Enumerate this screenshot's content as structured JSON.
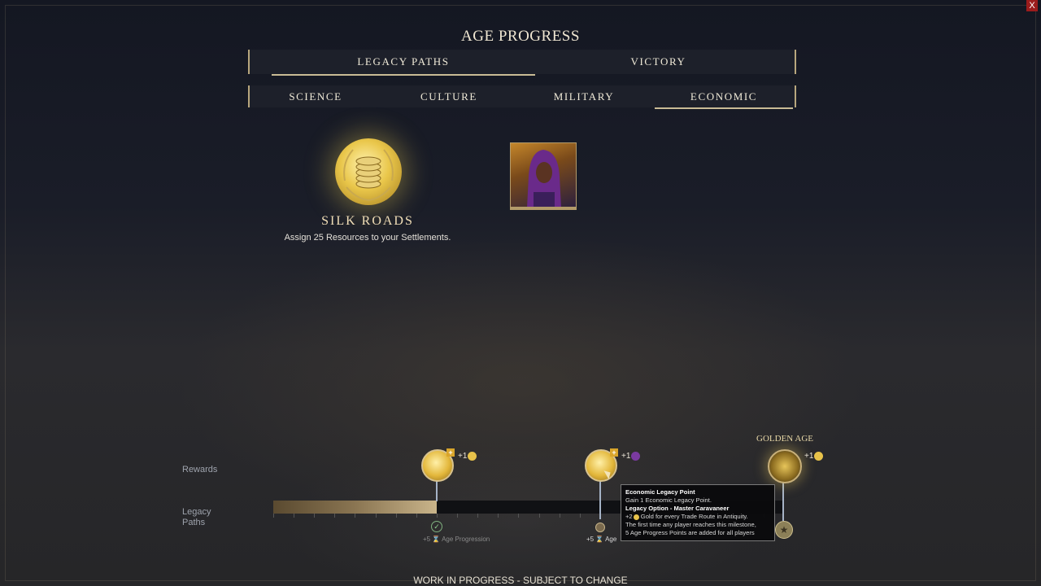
{
  "window": {
    "close_label": "X"
  },
  "title": "AGE PROGRESS",
  "main_tabs": [
    {
      "label": "LEGACY PATHS",
      "active": true
    },
    {
      "label": "VICTORY",
      "active": false
    }
  ],
  "sub_tabs": [
    {
      "label": "SCIENCE",
      "active": false
    },
    {
      "label": "CULTURE",
      "active": false
    },
    {
      "label": "MILITARY",
      "active": false
    },
    {
      "label": "ECONOMIC",
      "active": true
    }
  ],
  "legacy_path": {
    "icon": "gold-coins-laurel-icon",
    "title": "SILK ROADS",
    "description": "Assign 25 Resources to your Settlements."
  },
  "leader_portrait": {
    "icon": "leader-portrait-icon"
  },
  "progress": {
    "rows": {
      "rewards": "Rewards",
      "legacy_paths": "Legacy Paths"
    },
    "fill_fraction": 0.32,
    "milestones": [
      {
        "reward_text": "+1",
        "reward_icon": "gold-icon",
        "progression_text": "+5",
        "progression_label": "Age Progression",
        "completed": true
      },
      {
        "reward_text": "+1",
        "reward_icon": "purple-icon",
        "progression_text": "+5",
        "progression_label": "Age",
        "completed": false
      },
      {
        "reward_text": "+1",
        "reward_icon": "gold-icon",
        "completed": false,
        "label": "GOLDEN AGE"
      }
    ]
  },
  "tooltip": {
    "title": "Economic Legacy Point",
    "line1": "Gain 1 Economic Legacy Point.",
    "option": "Legacy Option - Master Caravaneer",
    "line2": "+2",
    "line2_rest": "Gold for every Trade Route in Antiquity.",
    "line3": "The first time any player reaches this milestone,",
    "line4": "5 Age Progress Points are added for all players"
  },
  "footer": "WORK IN PROGRESS - SUBJECT TO CHANGE",
  "colors": {
    "accent": "#c9bb95",
    "gold": "#e3b73b",
    "background": "#1a1d28"
  }
}
